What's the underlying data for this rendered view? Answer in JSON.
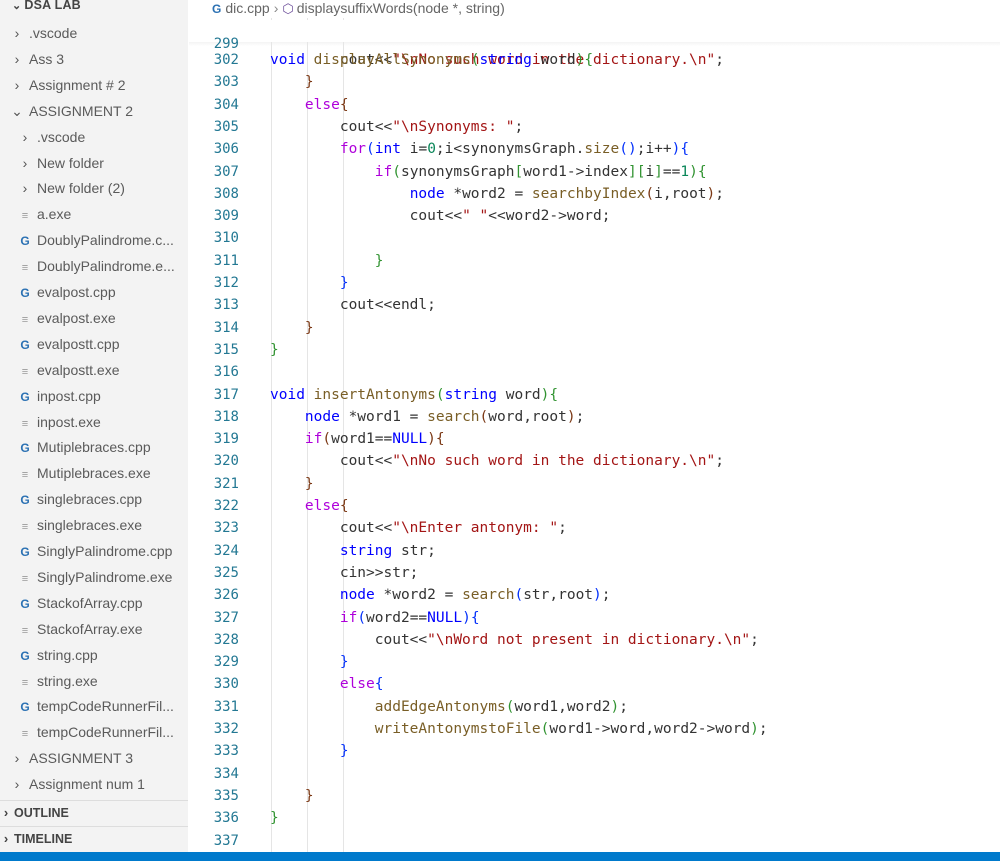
{
  "sidebar": {
    "workspace_title": "DSA LAB",
    "items": [
      {
        "label": ".vscode",
        "kind": "folder",
        "expanded": false,
        "depth": 0
      },
      {
        "label": "Ass 3",
        "kind": "folder",
        "expanded": false,
        "depth": 0
      },
      {
        "label": "Assignment # 2",
        "kind": "folder",
        "expanded": false,
        "depth": 0
      },
      {
        "label": "ASSIGNMENT 2",
        "kind": "folder",
        "expanded": true,
        "depth": 0
      },
      {
        "label": ".vscode",
        "kind": "folder",
        "expanded": false,
        "depth": 1
      },
      {
        "label": "New folder",
        "kind": "folder",
        "expanded": false,
        "depth": 1
      },
      {
        "label": "New folder (2)",
        "kind": "folder",
        "expanded": false,
        "depth": 1
      },
      {
        "label": "a.exe",
        "kind": "exe",
        "depth": 1
      },
      {
        "label": "DoublyPalindrome.c...",
        "kind": "cpp",
        "depth": 1
      },
      {
        "label": "DoublyPalindrome.e...",
        "kind": "exe",
        "depth": 1
      },
      {
        "label": "evalpost.cpp",
        "kind": "cpp",
        "depth": 1
      },
      {
        "label": "evalpost.exe",
        "kind": "exe",
        "depth": 1
      },
      {
        "label": "evalpostt.cpp",
        "kind": "cpp",
        "depth": 1
      },
      {
        "label": "evalpostt.exe",
        "kind": "exe",
        "depth": 1
      },
      {
        "label": "inpost.cpp",
        "kind": "cpp",
        "depth": 1
      },
      {
        "label": "inpost.exe",
        "kind": "exe",
        "depth": 1
      },
      {
        "label": "Mutiplebraces.cpp",
        "kind": "cpp",
        "depth": 1
      },
      {
        "label": "Mutiplebraces.exe",
        "kind": "exe",
        "depth": 1
      },
      {
        "label": "singlebraces.cpp",
        "kind": "cpp",
        "depth": 1
      },
      {
        "label": "singlebraces.exe",
        "kind": "exe",
        "depth": 1
      },
      {
        "label": "SinglyPalindrome.cpp",
        "kind": "cpp",
        "depth": 1
      },
      {
        "label": "SinglyPalindrome.exe",
        "kind": "exe",
        "depth": 1
      },
      {
        "label": "StackofArray.cpp",
        "kind": "cpp",
        "depth": 1
      },
      {
        "label": "StackofArray.exe",
        "kind": "exe",
        "depth": 1
      },
      {
        "label": "string.cpp",
        "kind": "cpp",
        "depth": 1
      },
      {
        "label": "string.exe",
        "kind": "exe",
        "depth": 1
      },
      {
        "label": "tempCodeRunnerFil...",
        "kind": "cpp",
        "depth": 1
      },
      {
        "label": "tempCodeRunnerFil...",
        "kind": "exe",
        "depth": 1
      },
      {
        "label": "ASSIGNMENT 3",
        "kind": "folder",
        "expanded": false,
        "depth": 0
      },
      {
        "label": "Assignment num 1",
        "kind": "folder",
        "expanded": false,
        "depth": 0
      }
    ],
    "outline_label": "OUTLINE",
    "timeline_label": "TIMELINE"
  },
  "breadcrumb": {
    "file": "dic.cpp",
    "symbol": "displaysuffixWords(node *, string)"
  },
  "editor": {
    "sticky_line": {
      "number": "299",
      "text": "void displayAllSynonyms(string word){"
    },
    "lines": [
      {
        "n": "302",
        "text": "        cout<<\"\\nNo such word in the dictionary.\\n\";"
      },
      {
        "n": "303",
        "text": "    }"
      },
      {
        "n": "304",
        "text": "    else{"
      },
      {
        "n": "305",
        "text": "        cout<<\"\\nSynonyms: \";"
      },
      {
        "n": "306",
        "text": "        for(int i=0;i<synonymsGraph.size();i++){"
      },
      {
        "n": "307",
        "text": "            if(synonymsGraph[word1->index][i]==1){"
      },
      {
        "n": "308",
        "text": "                node *word2 = searchbyIndex(i,root);"
      },
      {
        "n": "309",
        "text": "                cout<<\" \"<<word2->word;"
      },
      {
        "n": "310",
        "text": ""
      },
      {
        "n": "311",
        "text": "            }"
      },
      {
        "n": "312",
        "text": "        }"
      },
      {
        "n": "313",
        "text": "        cout<<endl;"
      },
      {
        "n": "314",
        "text": "    }"
      },
      {
        "n": "315",
        "text": "}"
      },
      {
        "n": "316",
        "text": ""
      },
      {
        "n": "317",
        "text": "void insertAntonyms(string word){"
      },
      {
        "n": "318",
        "text": "    node *word1 = search(word,root);"
      },
      {
        "n": "319",
        "text": "    if(word1==NULL){"
      },
      {
        "n": "320",
        "text": "        cout<<\"\\nNo such word in the dictionary.\\n\";"
      },
      {
        "n": "321",
        "text": "    }"
      },
      {
        "n": "322",
        "text": "    else{"
      },
      {
        "n": "323",
        "text": "        cout<<\"\\nEnter antonym: \";"
      },
      {
        "n": "324",
        "text": "        string str;"
      },
      {
        "n": "325",
        "text": "        cin>>str;"
      },
      {
        "n": "326",
        "text": "        node *word2 = search(str,root);"
      },
      {
        "n": "327",
        "text": "        if(word2==NULL){"
      },
      {
        "n": "328",
        "text": "            cout<<\"\\nWord not present in dictionary.\\n\";"
      },
      {
        "n": "329",
        "text": "        }"
      },
      {
        "n": "330",
        "text": "        else{"
      },
      {
        "n": "331",
        "text": "            addEdgeAntonyms(word1,word2);"
      },
      {
        "n": "332",
        "text": "            writeAntonymstoFile(word1->word,word2->word);"
      },
      {
        "n": "333",
        "text": "        }"
      },
      {
        "n": "334",
        "text": ""
      },
      {
        "n": "335",
        "text": "    }"
      },
      {
        "n": "336",
        "text": "}"
      },
      {
        "n": "337",
        "text": ""
      }
    ]
  },
  "colors": {
    "sidebar_bg": "#f3f3f3",
    "line_number": "#237893",
    "keyword": "#0000ff",
    "control": "#af00db",
    "string": "#a31515",
    "function": "#795e26",
    "number": "#098658",
    "status_bar": "#007acc"
  }
}
